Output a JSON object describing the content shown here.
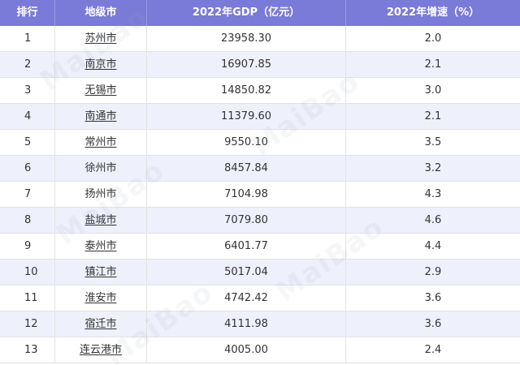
{
  "table": {
    "headers": [
      "排行",
      "地级市",
      "2022年GDP（亿元）",
      "2022年增速（%）"
    ],
    "rows": [
      {
        "rank": "1",
        "city": "苏州市",
        "city_linked": true,
        "gdp": "23958.30",
        "rate": "2.0"
      },
      {
        "rank": "2",
        "city": "南京市",
        "city_linked": true,
        "gdp": "16907.85",
        "rate": "2.1"
      },
      {
        "rank": "3",
        "city": "无锡市",
        "city_linked": true,
        "gdp": "14850.82",
        "rate": "3.0"
      },
      {
        "rank": "4",
        "city": "南通市",
        "city_linked": true,
        "gdp": "11379.60",
        "rate": "2.1"
      },
      {
        "rank": "5",
        "city": "常州市",
        "city_linked": true,
        "gdp": "9550.10",
        "rate": "3.5"
      },
      {
        "rank": "6",
        "city": "徐州市",
        "city_linked": false,
        "gdp": "8457.84",
        "rate": "3.2"
      },
      {
        "rank": "7",
        "city": "扬州市",
        "city_linked": false,
        "gdp": "7104.98",
        "rate": "4.3"
      },
      {
        "rank": "8",
        "city": "盐城市",
        "city_linked": true,
        "gdp": "7079.80",
        "rate": "4.6"
      },
      {
        "rank": "9",
        "city": "泰州市",
        "city_linked": true,
        "gdp": "6401.77",
        "rate": "4.4"
      },
      {
        "rank": "10",
        "city": "镇江市",
        "city_linked": true,
        "gdp": "5017.04",
        "rate": "2.9"
      },
      {
        "rank": "11",
        "city": "淮安市",
        "city_linked": true,
        "gdp": "4742.42",
        "rate": "3.6"
      },
      {
        "rank": "12",
        "city": "宿迁市",
        "city_linked": true,
        "gdp": "4111.98",
        "rate": "3.6"
      },
      {
        "rank": "13",
        "city": "连云港市",
        "city_linked": true,
        "gdp": "4005.00",
        "rate": "2.4"
      }
    ]
  },
  "colors": {
    "header_bg": "#7a7ad8",
    "alt_row_bg": "#eef0fb",
    "text": "#333333"
  },
  "watermark_text": "MaiBao"
}
